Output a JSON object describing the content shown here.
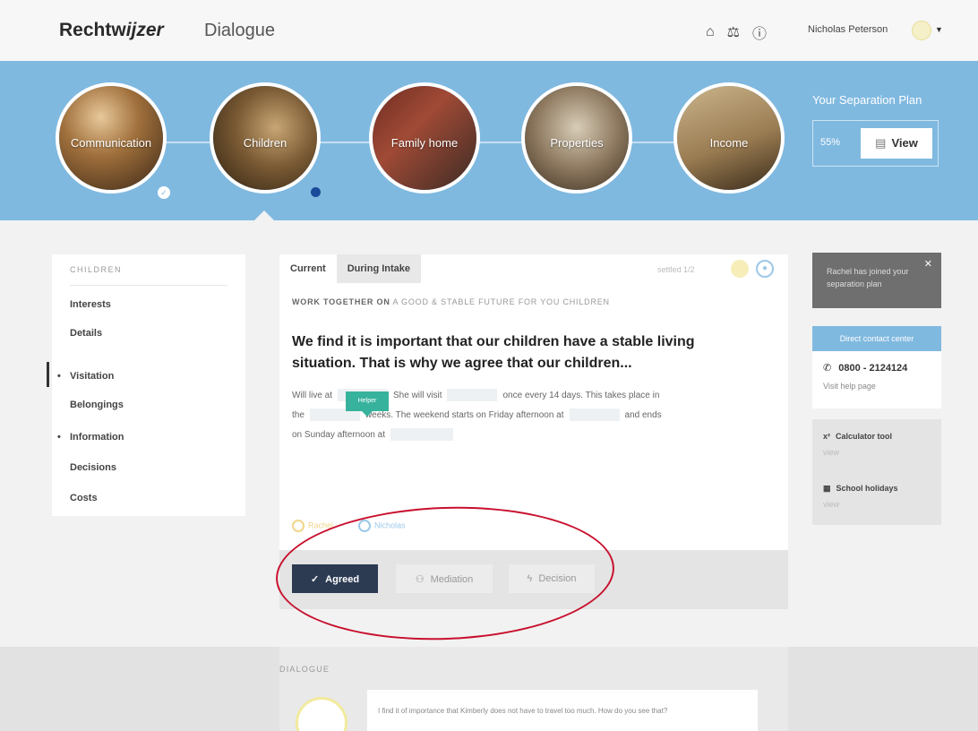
{
  "header": {
    "brand_main": "Rechtw",
    "brand_italic": "ijzer",
    "product": "Dialogue",
    "user_name": "Nicholas Peterson",
    "icons": [
      "home-icon",
      "scales-icon",
      "help-icon",
      "user-avatar",
      "chevron-down-icon"
    ]
  },
  "stages": [
    {
      "label": "Communication",
      "status": "completed"
    },
    {
      "label": "Children",
      "status": "active"
    },
    {
      "label": "Family home",
      "status": "open"
    },
    {
      "label": "Properties",
      "status": "open"
    },
    {
      "label": "Income",
      "status": "open"
    }
  ],
  "plan": {
    "title": "Your Separation Plan",
    "percent": "55%",
    "view_label": "View"
  },
  "sidebar": {
    "heading": "CHILDREN",
    "items": [
      {
        "label": "Interests",
        "dot": false
      },
      {
        "label": "Details",
        "dot": false
      },
      {
        "label": "Visitation",
        "dot": true,
        "active": true
      },
      {
        "label": "Belongings",
        "dot": false
      },
      {
        "label": "Information",
        "dot": true
      },
      {
        "label": "Decisions",
        "dot": false
      },
      {
        "label": "Costs",
        "dot": false
      }
    ]
  },
  "main": {
    "tabs": [
      "Current",
      "During Intake"
    ],
    "settled": "settled 1/2",
    "subtitle_bold": "WORK TOGETHER ON",
    "subtitle_rest": "A GOOD & STABLE FUTURE FOR YOU CHILDREN",
    "title": "We find it is important that our children have a stable living situation. That is why we agree that our children...",
    "body_1": "Will live at",
    "body_2": "She will visit",
    "body_3": "once every 14 days. This takes place in",
    "body_4": "the",
    "body_5": "weeks. The weekend starts on Friday afternoon at",
    "body_6": "and ends",
    "body_7": "on Sunday afternoon at",
    "tooltip": "Helper",
    "status_1": "Rachel",
    "status_2": "Nicholas",
    "buttons": {
      "agreed": "Agreed",
      "mediation": "Mediation",
      "decision": "Decision"
    }
  },
  "right": {
    "notice": "Rachel has joined your separation plan",
    "contact_button": "Direct contact center",
    "phone": "0800 - 2124124",
    "help_link": "Visit help page",
    "tools": [
      {
        "icon": "x²",
        "label": "Calculator tool",
        "link": "view"
      },
      {
        "icon": "calendar-icon",
        "label": "School holidays",
        "link": "view"
      }
    ]
  },
  "dialogue": {
    "heading": "DIALOGUE",
    "message": "I find it of importance that Kimberly does not have to travel too much. How do you see that?"
  },
  "colors": {
    "band": "#80b9e0",
    "agreed_button": "#2c3a52",
    "annotation": "#c8102e",
    "teal": "#37b29c"
  }
}
